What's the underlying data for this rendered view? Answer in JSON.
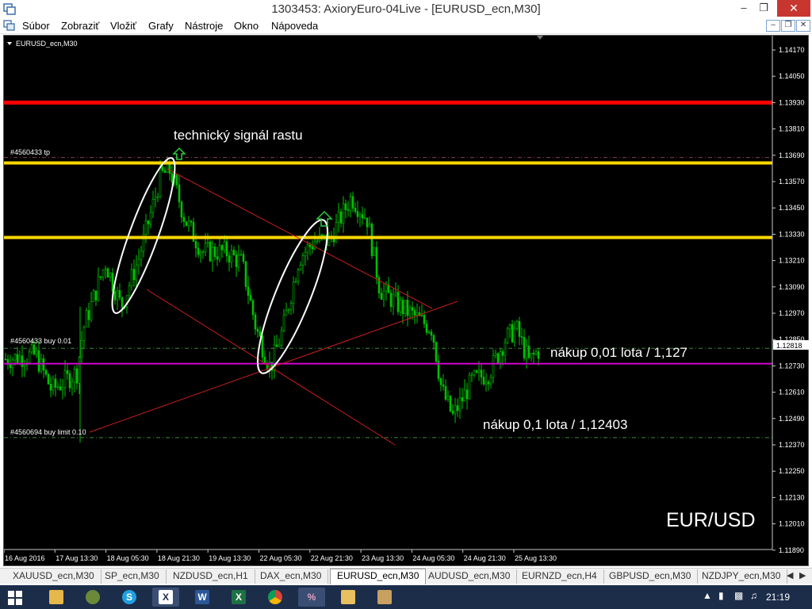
{
  "window": {
    "title": "1303453: AxioryEuro-04Live - [EURUSD_ecn,M30]",
    "controls": {
      "minimize": "–",
      "maximize": "❐",
      "close": "✕"
    }
  },
  "menu": {
    "items": [
      "Súbor",
      "Zobraziť",
      "Vložiť",
      "Grafy",
      "Nástroje",
      "Okno",
      "Nápoveda"
    ],
    "mdi_controls": [
      "–",
      "❐",
      "✕"
    ]
  },
  "chart": {
    "symbol_label": "EURUSD_ecn,M30",
    "watermark": "EUR/USD",
    "annotations": {
      "signal": "technický signál rastu",
      "buy_small": "nákup 0,01 lota / 1,127",
      "buy_large": "nákup 0,1 lota / 1,12403"
    },
    "order_labels": {
      "tp": "#4560433 tp",
      "buy": "#4560433 buy 0.01",
      "buy_limit": "#4560694 buy limit 0.10"
    },
    "current_price": "1.12818",
    "price_ticks": [
      "1.14170",
      "1.14050",
      "1.13930",
      "1.13810",
      "1.13690",
      "1.13570",
      "1.13450",
      "1.13330",
      "1.13210",
      "1.13090",
      "1.12970",
      "1.12850",
      "1.12730",
      "1.12610",
      "1.12490",
      "1.12370",
      "1.12250",
      "1.12130",
      "1.12010",
      "1.11890"
    ],
    "time_ticks": [
      "16 Aug 2016",
      "17 Aug 13:30",
      "18 Aug 05:30",
      "18 Aug 21:30",
      "19 Aug 13:30",
      "22 Aug 05:30",
      "22 Aug 21:30",
      "23 Aug 13:30",
      "24 Aug 05:30",
      "24 Aug 21:30",
      "25 Aug 13:30"
    ],
    "levels": {
      "red_resistance": 1.1393,
      "yellow_upper": 1.13655,
      "yellow_lower": 1.13315,
      "magenta": 1.1274,
      "tp": 1.1368,
      "buy": 1.1281,
      "buy_limit": 1.12403
    },
    "colors": {
      "background": "#000000",
      "candle": "#00c000",
      "grid_text": "#ffffff",
      "red_line": "#ff0000",
      "yellow_line": "#ffd700",
      "magenta_line": "#d000d0",
      "trend_line": "#c81e1e",
      "order_dash": "#3a8a3a",
      "annotation": "#ffffff",
      "arrow": "#2ecc40"
    }
  },
  "tabs": {
    "items": [
      "XAUUSD_ecn,M30",
      "SP_ecn,M30",
      "NZDUSD_ecn,H1",
      "DAX_ecn,M30",
      "EURUSD_ecn,M30",
      "AUDUSD_ecn,M30",
      "EURNZD_ecn,H4",
      "GBPUSD_ecn,M30",
      "NZDJPY_ecn,M30"
    ],
    "active": "EURUSD_ecn,M30"
  },
  "taskbar": {
    "apps": [
      "start",
      "explorer-window",
      "finder",
      "skype",
      "xtrade",
      "word",
      "excel",
      "chrome",
      "metatrader",
      "folder",
      "calc"
    ],
    "time": "21:19"
  }
}
